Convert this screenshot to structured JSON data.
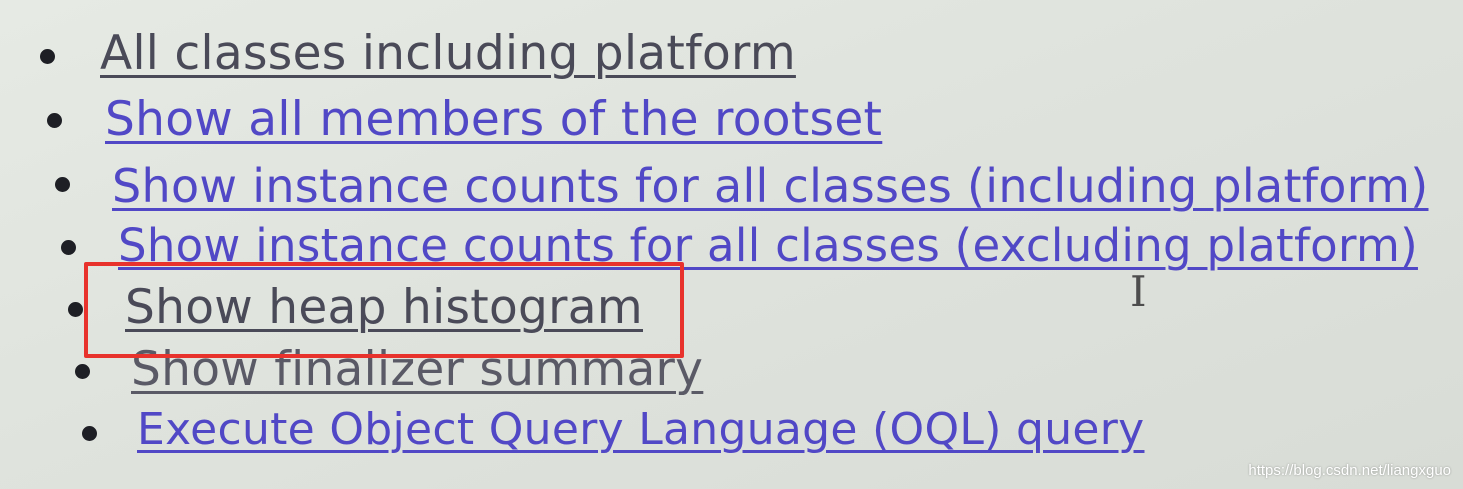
{
  "links": [
    {
      "label": "All classes including platform",
      "state": "visited"
    },
    {
      "label": "Show all members of the rootset",
      "state": "unvisited"
    },
    {
      "label": "Show instance counts for all classes (including platform)",
      "state": "unvisited"
    },
    {
      "label": "Show instance counts for all classes (excluding platform)",
      "state": "unvisited"
    },
    {
      "label": "Show heap histogram",
      "state": "visited",
      "highlighted": true
    },
    {
      "label": "Show finalizer summary",
      "state": "visited"
    },
    {
      "label": "Execute Object Query Language (OQL) query",
      "state": "unvisited"
    }
  ],
  "annotation": {
    "highlighted_item": "Show heap histogram",
    "box_color": "#e8322c"
  },
  "cursor": {
    "glyph": "I",
    "icon": "text-cursor-icon"
  },
  "watermark": {
    "text": "https://blog.csdn.net/liangxguo"
  },
  "colors": {
    "link_unvisited": "#5148c6",
    "link_visited": "#4a4a58",
    "bullet": "#1e1f25",
    "background": "#e2e6e0"
  }
}
